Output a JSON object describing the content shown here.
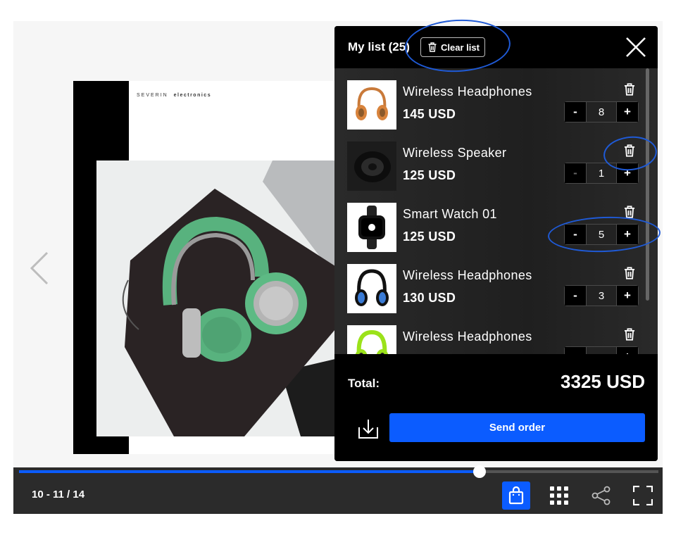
{
  "book": {
    "brand_name": "SEVERIN",
    "brand_sub": "electronics"
  },
  "cart": {
    "title": "My list (25)",
    "clear_label": "Clear list",
    "items": [
      {
        "name": "Wireless Headphones",
        "price": "145 USD",
        "quantity": "8",
        "thumb": "orange-headphones"
      },
      {
        "name": "Wireless Speaker",
        "price": "125 USD",
        "quantity": "1",
        "thumb": "black-speaker"
      },
      {
        "name": "Smart Watch 01",
        "price": "125 USD",
        "quantity": "5",
        "thumb": "black-smartwatch"
      },
      {
        "name": "Wireless Headphones",
        "price": "130 USD",
        "quantity": "3",
        "thumb": "blue-headphones"
      },
      {
        "name": "Wireless Headphones",
        "price": "",
        "quantity": "",
        "thumb": "lime-headphones"
      }
    ],
    "minus_label": "-",
    "plus_label": "+",
    "total_label": "Total:",
    "total_value": "3325 USD",
    "send_label": "Send order"
  },
  "toolbar": {
    "page_counter": "10 - 11 / 14",
    "progress": 0.72,
    "icons": [
      "shopping-bag-icon",
      "grid-icon",
      "share-icon",
      "fullscreen-icon"
    ],
    "accent": "#0b5cff"
  }
}
